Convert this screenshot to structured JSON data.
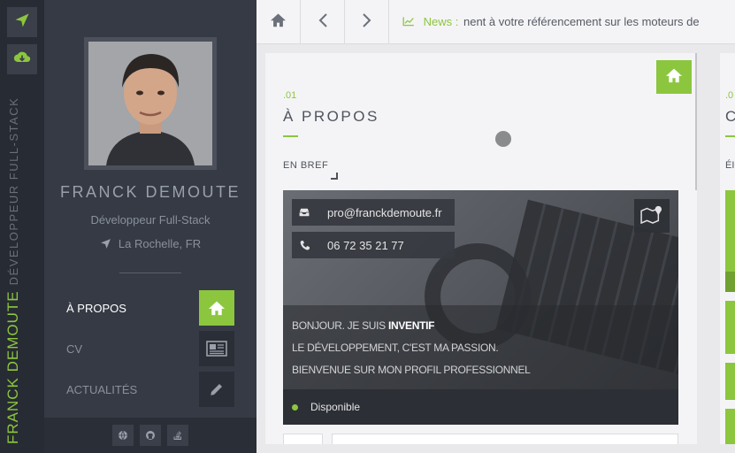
{
  "colors": {
    "accent": "#8cc63f",
    "sidebar": "#353a44",
    "rail": "#272b33"
  },
  "rail": {
    "send_icon": "paper-plane-icon",
    "download_icon": "cloud-download-icon",
    "vertical_name": "FRANCK DEMOUTE",
    "vertical_role": "DÉVELOPPEUR FULL-STACK"
  },
  "profile": {
    "name": "FRANCK DEMOUTE",
    "role": "Développeur Full-Stack",
    "location": "La Rochelle, FR"
  },
  "nav": [
    {
      "label": "À PROPOS",
      "icon": "home-icon",
      "active": true
    },
    {
      "label": "CV",
      "icon": "newspaper-icon",
      "active": false
    },
    {
      "label": "ACTUALITÉS",
      "icon": "pencil-icon",
      "active": false
    }
  ],
  "footer_icons": [
    "globe-icon",
    "github-icon",
    "stack-overflow-icon"
  ],
  "topbar": {
    "news_label": "News :",
    "news_text": "nent à votre référencement sur les moteurs de"
  },
  "about": {
    "number": ".01",
    "title": "À PROPOS",
    "subtitle": "EN BREF",
    "email": "pro@franckdemoute.fr",
    "phone": "06 72 35 21 77",
    "intro_prefix": "BONJOUR. JE SUIS",
    "intro_bold": "INVENTIF",
    "intro_line2": "LE DÉVELOPPEMENT, C'EST MA PASSION.",
    "intro_line3": "BIENVENUE SUR MON PROFIL PROFESSIONNEL",
    "status": "Disponible"
  },
  "next_card": {
    "number": ".0",
    "title": "C",
    "subtitle": "ÉI"
  }
}
